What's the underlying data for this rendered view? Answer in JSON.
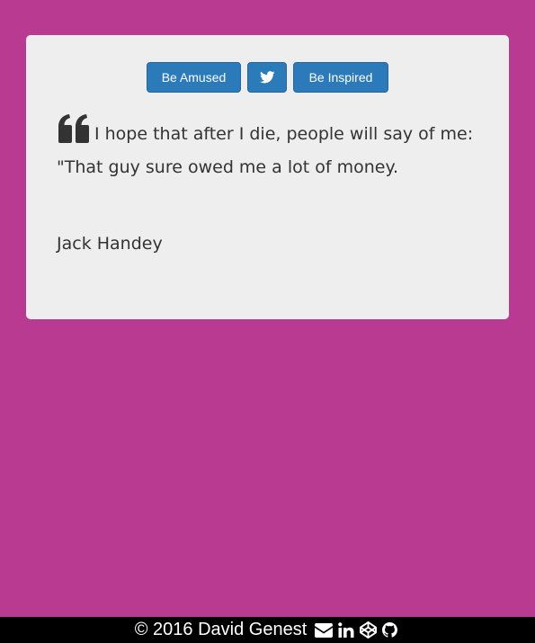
{
  "buttons": {
    "amused_label": "Be Amused",
    "twitter_icon": "twitter-icon",
    "inspired_label": "Be Inspired"
  },
  "quote": {
    "icon": "quote-left-icon",
    "text": "I hope that after I die, people will say of me: \"That guy sure owed me a lot of money.",
    "author": "Jack Handey"
  },
  "footer": {
    "copyright": "© 2016 David Genest",
    "icons": [
      "envelope-icon",
      "linkedin-icon",
      "codepen-icon",
      "github-icon"
    ]
  },
  "colors": {
    "background": "#b83b91",
    "card": "#eeeeee",
    "button": "#2b7bbb",
    "footer": "#000000"
  }
}
